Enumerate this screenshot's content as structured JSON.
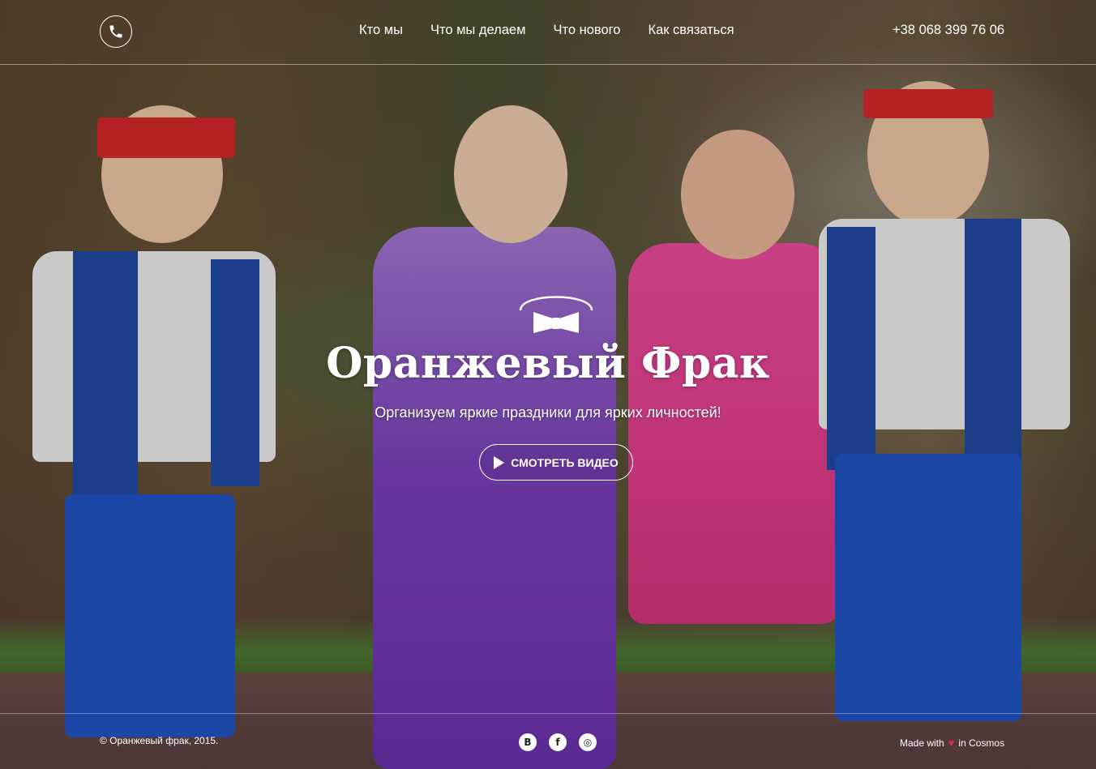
{
  "header": {
    "phone_icon": "phone-icon",
    "nav": [
      {
        "label": "Кто мы"
      },
      {
        "label": "Что мы делаем"
      },
      {
        "label": "Что нового"
      },
      {
        "label": "Как связаться"
      }
    ],
    "phone_number": "+38 068 399 76 06"
  },
  "hero": {
    "logo_icon": "bow-tie-icon",
    "title": "Оранжевый Фрак",
    "subtitle": "Организуем яркие праздники для ярких личностей!",
    "video_button": "СМОТРЕТЬ ВИДЕО"
  },
  "footer": {
    "copyright": "© Оранжевый фрак, 2015.",
    "socials": [
      {
        "icon": "vk-icon",
        "glyph": "B"
      },
      {
        "icon": "facebook-icon",
        "glyph": "f"
      },
      {
        "icon": "instagram-icon",
        "glyph": "◎"
      }
    ],
    "made_with_prefix": "Made with",
    "made_with_suffix": "in Cosmos"
  },
  "colors": {
    "text": "#ffffff",
    "heart": "#e0245e"
  }
}
